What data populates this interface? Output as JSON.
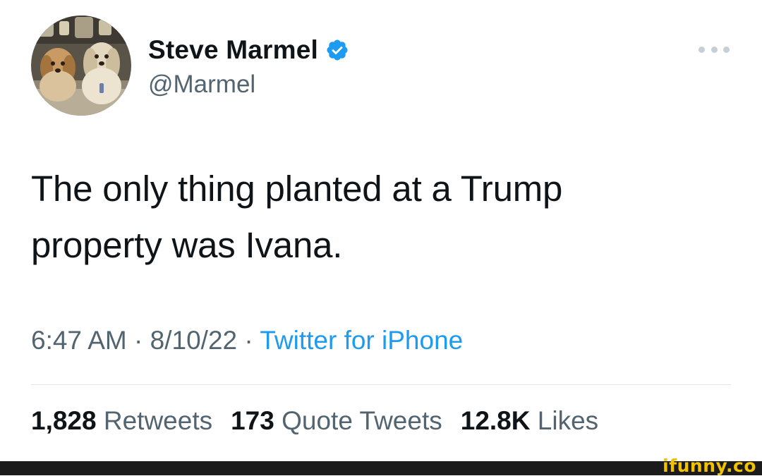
{
  "author": {
    "display_name": "Steve Marmel",
    "handle": "@Marmel",
    "verified": true,
    "avatar_icon": "avatar-photo-two-dogs"
  },
  "tweet": {
    "text_line1": "The only thing planted at a Trump",
    "text_line2": "property was Ivana."
  },
  "meta": {
    "time": "6:47 AM",
    "date": "8/10/22",
    "source": "Twitter for iPhone",
    "separator": " · "
  },
  "stats": {
    "retweets_count": "1,828",
    "retweets_label": "Retweets",
    "quotes_count": "173",
    "quotes_label": "Quote Tweets",
    "likes_count": "12.8K",
    "likes_label": "Likes"
  },
  "watermark": {
    "text": "ifunny.co"
  },
  "colors": {
    "text_primary": "#0f1419",
    "text_secondary": "#536471",
    "link_blue": "#1d9bf0",
    "verified_blue": "#1d9bf0",
    "watermark_yellow": "#f2c200",
    "footer_bar": "#1b1b1b"
  }
}
